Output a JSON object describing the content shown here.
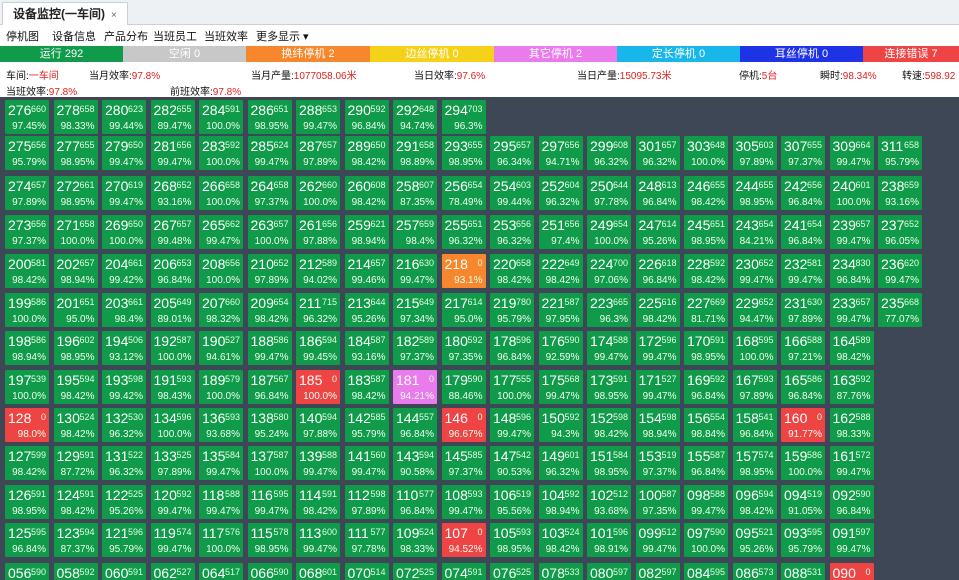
{
  "tab": {
    "title": "设备监控(一车间)",
    "close": "×"
  },
  "menu": [
    "停机图",
    "设备信息",
    "产品分布",
    "当班员工",
    "当班效率",
    "更多显示 ▾"
  ],
  "status": [
    {
      "label": "运行 292",
      "color": "#0f9b49"
    },
    {
      "label": "空闲 0",
      "color": "#c8c8c8"
    },
    {
      "label": "换纬停机 2",
      "color": "#f7872d"
    },
    {
      "label": "边丝停机 0",
      "color": "#f5d21a"
    },
    {
      "label": "其它停机 2",
      "color": "#ea7bec"
    },
    {
      "label": "定长停机 0",
      "color": "#19b7e9"
    },
    {
      "label": "耳丝停机 0",
      "color": "#1e32e6"
    },
    {
      "label": "连接错误 7",
      "color": "#ee4444"
    }
  ],
  "info": {
    "workshop_label": "车间:",
    "workshop": "一车间",
    "month_eff_label": "当月效率:",
    "month_eff": "97.8%",
    "month_out_label": "当月产量:",
    "month_out": "1077058.06米",
    "day_eff_label": "当日效率:",
    "day_eff": "97.6%",
    "day_out_label": "当日产量:",
    "day_out": "15095.73米",
    "stop_label": "停机:",
    "stop": "5台",
    "instant_label": "瞬时:",
    "instant": "98.34%",
    "speed_label": "转速:",
    "speed": "598.92",
    "shift_eff_label": "当班效率:",
    "shift_eff": "97.8%",
    "prev_eff_label": "前班效率:",
    "prev_eff": "97.8%"
  },
  "grid": [
    [
      [
        "276",
        "660",
        "97.45%",
        "g"
      ],
      [
        "278",
        "658",
        "98.33%",
        "g"
      ],
      [
        "280",
        "623",
        "99.44%",
        "g"
      ],
      [
        "282",
        "655",
        "89.47%",
        "g"
      ],
      [
        "284",
        "591",
        "100.0%",
        "g"
      ],
      [
        "286",
        "651",
        "98.95%",
        "g"
      ],
      [
        "288",
        "653",
        "99.47%",
        "g"
      ],
      [
        "290",
        "592",
        "96.84%",
        "g"
      ],
      [
        "292",
        "648",
        "94.74%",
        "g"
      ],
      [
        "294",
        "703",
        "96.3%",
        "g"
      ]
    ],
    [
      [
        "275",
        "656",
        "95.79%",
        "g"
      ],
      [
        "277",
        "655",
        "98.95%",
        "g"
      ],
      [
        "279",
        "650",
        "99.47%",
        "g"
      ],
      [
        "281",
        "656",
        "99.47%",
        "g"
      ],
      [
        "283",
        "592",
        "100.0%",
        "g"
      ],
      [
        "285",
        "624",
        "99.47%",
        "g"
      ],
      [
        "287",
        "657",
        "97.89%",
        "g"
      ],
      [
        "289",
        "650",
        "98.42%",
        "g"
      ],
      [
        "291",
        "658",
        "98.89%",
        "g"
      ],
      [
        "293",
        "655",
        "98.95%",
        "g"
      ],
      [
        "295",
        "657",
        "96.34%",
        "g"
      ],
      [
        "297",
        "656",
        "94.71%",
        "g"
      ],
      [
        "299",
        "608",
        "96.32%",
        "g"
      ],
      [
        "301",
        "657",
        "96.32%",
        "g"
      ],
      [
        "303",
        "648",
        "100.0%",
        "g"
      ],
      [
        "305",
        "603",
        "97.89%",
        "g"
      ],
      [
        "307",
        "655",
        "97.37%",
        "g"
      ],
      [
        "309",
        "664",
        "99.47%",
        "g"
      ],
      [
        "311",
        "658",
        "95.79%",
        "g"
      ]
    ],
    [
      [
        "274",
        "657",
        "97.89%",
        "g"
      ],
      [
        "272",
        "661",
        "98.95%",
        "g"
      ],
      [
        "270",
        "619",
        "99.47%",
        "g"
      ],
      [
        "268",
        "652",
        "93.16%",
        "g"
      ],
      [
        "266",
        "658",
        "100.0%",
        "g"
      ],
      [
        "264",
        "658",
        "97.37%",
        "g"
      ],
      [
        "262",
        "660",
        "100.0%",
        "g"
      ],
      [
        "260",
        "608",
        "98.42%",
        "g"
      ],
      [
        "258",
        "607",
        "87.35%",
        "g"
      ],
      [
        "256",
        "654",
        "78.49%",
        "g"
      ],
      [
        "254",
        "603",
        "99.44%",
        "g"
      ],
      [
        "252",
        "604",
        "96.32%",
        "g"
      ],
      [
        "250",
        "644",
        "97.78%",
        "g"
      ],
      [
        "248",
        "613",
        "96.84%",
        "g"
      ],
      [
        "246",
        "655",
        "98.42%",
        "g"
      ],
      [
        "244",
        "655",
        "98.95%",
        "g"
      ],
      [
        "242",
        "656",
        "96.84%",
        "g"
      ],
      [
        "240",
        "601",
        "100.0%",
        "g"
      ],
      [
        "238",
        "659",
        "93.16%",
        "g"
      ]
    ],
    [
      [
        "273",
        "656",
        "97.37%",
        "g"
      ],
      [
        "271",
        "658",
        "100.0%",
        "g"
      ],
      [
        "269",
        "650",
        "100.0%",
        "g"
      ],
      [
        "267",
        "657",
        "99.48%",
        "g"
      ],
      [
        "265",
        "662",
        "99.47%",
        "g"
      ],
      [
        "263",
        "657",
        "100.0%",
        "g"
      ],
      [
        "261",
        "656",
        "97.88%",
        "g"
      ],
      [
        "259",
        "621",
        "98.94%",
        "g"
      ],
      [
        "257",
        "659",
        "98.4%",
        "g"
      ],
      [
        "255",
        "651",
        "96.32%",
        "g"
      ],
      [
        "253",
        "656",
        "96.32%",
        "g"
      ],
      [
        "251",
        "656",
        "97.4%",
        "g"
      ],
      [
        "249",
        "654",
        "100.0%",
        "g"
      ],
      [
        "247",
        "614",
        "95.26%",
        "g"
      ],
      [
        "245",
        "651",
        "98.95%",
        "g"
      ],
      [
        "243",
        "654",
        "84.21%",
        "g"
      ],
      [
        "241",
        "654",
        "96.84%",
        "g"
      ],
      [
        "239",
        "657",
        "99.47%",
        "g"
      ],
      [
        "237",
        "652",
        "96.05%",
        "g"
      ]
    ],
    [
      [
        "200",
        "581",
        "98.42%",
        "g"
      ],
      [
        "202",
        "657",
        "98.94%",
        "g"
      ],
      [
        "204",
        "661",
        "99.42%",
        "g"
      ],
      [
        "206",
        "653",
        "96.84%",
        "g"
      ],
      [
        "208",
        "656",
        "100.0%",
        "g"
      ],
      [
        "210",
        "652",
        "97.89%",
        "g"
      ],
      [
        "212",
        "589",
        "94.02%",
        "g"
      ],
      [
        "214",
        "657",
        "99.46%",
        "g"
      ],
      [
        "216",
        "630",
        "99.47%",
        "g"
      ],
      [
        "218",
        "0",
        "93.1%",
        "o"
      ],
      [
        "220",
        "658",
        "98.42%",
        "g"
      ],
      [
        "222",
        "649",
        "98.42%",
        "g"
      ],
      [
        "224",
        "700",
        "97.06%",
        "g"
      ],
      [
        "226",
        "618",
        "96.84%",
        "g"
      ],
      [
        "228",
        "592",
        "98.42%",
        "g"
      ],
      [
        "230",
        "652",
        "99.47%",
        "g"
      ],
      [
        "232",
        "581",
        "99.47%",
        "g"
      ],
      [
        "234",
        "830",
        "96.84%",
        "g"
      ],
      [
        "236",
        "620",
        "99.47%",
        "g"
      ]
    ],
    [
      [
        "199",
        "586",
        "100.0%",
        "g"
      ],
      [
        "201",
        "651",
        "95.0%",
        "g"
      ],
      [
        "203",
        "661",
        "98.4%",
        "g"
      ],
      [
        "205",
        "649",
        "89.01%",
        "g"
      ],
      [
        "207",
        "660",
        "98.32%",
        "g"
      ],
      [
        "209",
        "654",
        "98.42%",
        "g"
      ],
      [
        "211",
        "715",
        "96.32%",
        "g"
      ],
      [
        "213",
        "644",
        "95.26%",
        "g"
      ],
      [
        "215",
        "649",
        "97.34%",
        "g"
      ],
      [
        "217",
        "614",
        "95.0%",
        "g"
      ],
      [
        "219",
        "780",
        "95.79%",
        "g"
      ],
      [
        "221",
        "587",
        "97.95%",
        "g"
      ],
      [
        "223",
        "665",
        "96.3%",
        "g"
      ],
      [
        "225",
        "616",
        "98.42%",
        "g"
      ],
      [
        "227",
        "669",
        "81.71%",
        "g"
      ],
      [
        "229",
        "652",
        "94.47%",
        "g"
      ],
      [
        "231",
        "630",
        "97.89%",
        "g"
      ],
      [
        "233",
        "657",
        "99.47%",
        "g"
      ],
      [
        "235",
        "668",
        "77.07%",
        "g"
      ]
    ],
    [
      [
        "198",
        "586",
        "98.94%",
        "g"
      ],
      [
        "196",
        "602",
        "98.95%",
        "g"
      ],
      [
        "194",
        "506",
        "93.12%",
        "g"
      ],
      [
        "192",
        "587",
        "100.0%",
        "g"
      ],
      [
        "190",
        "527",
        "94.61%",
        "g"
      ],
      [
        "188",
        "586",
        "99.47%",
        "g"
      ],
      [
        "186",
        "594",
        "99.45%",
        "g"
      ],
      [
        "184",
        "587",
        "93.16%",
        "g"
      ],
      [
        "182",
        "589",
        "97.37%",
        "g"
      ],
      [
        "180",
        "592",
        "97.35%",
        "g"
      ],
      [
        "178",
        "596",
        "96.84%",
        "g"
      ],
      [
        "176",
        "590",
        "92.59%",
        "g"
      ],
      [
        "174",
        "588",
        "99.47%",
        "g"
      ],
      [
        "172",
        "596",
        "99.47%",
        "g"
      ],
      [
        "170",
        "591",
        "98.95%",
        "g"
      ],
      [
        "168",
        "595",
        "100.0%",
        "g"
      ],
      [
        "166",
        "588",
        "97.21%",
        "g"
      ],
      [
        "164",
        "589",
        "98.42%",
        "g"
      ]
    ],
    [
      [
        "197",
        "539",
        "100.0%",
        "g"
      ],
      [
        "195",
        "594",
        "98.42%",
        "g"
      ],
      [
        "193",
        "598",
        "99.42%",
        "g"
      ],
      [
        "191",
        "593",
        "98.43%",
        "g"
      ],
      [
        "189",
        "579",
        "100.0%",
        "g"
      ],
      [
        "187",
        "567",
        "96.84%",
        "g"
      ],
      [
        "185",
        "0",
        "100.0%",
        "r"
      ],
      [
        "183",
        "587",
        "98.42%",
        "g"
      ],
      [
        "181",
        "0",
        "94.21%",
        "p"
      ],
      [
        "179",
        "590",
        "88.46%",
        "g"
      ],
      [
        "177",
        "555",
        "100.0%",
        "g"
      ],
      [
        "175",
        "568",
        "99.47%",
        "g"
      ],
      [
        "173",
        "591",
        "98.95%",
        "g"
      ],
      [
        "171",
        "527",
        "99.47%",
        "g"
      ],
      [
        "169",
        "592",
        "96.84%",
        "g"
      ],
      [
        "167",
        "593",
        "97.89%",
        "g"
      ],
      [
        "165",
        "586",
        "96.84%",
        "g"
      ],
      [
        "163",
        "592",
        "87.76%",
        "g"
      ]
    ],
    [
      [
        "128",
        "0",
        "98.0%",
        "r"
      ],
      [
        "130",
        "524",
        "98.42%",
        "g"
      ],
      [
        "132",
        "530",
        "96.32%",
        "g"
      ],
      [
        "134",
        "596",
        "100.0%",
        "g"
      ],
      [
        "136",
        "593",
        "93.68%",
        "g"
      ],
      [
        "138",
        "580",
        "95.24%",
        "g"
      ],
      [
        "140",
        "594",
        "97.88%",
        "g"
      ],
      [
        "142",
        "585",
        "95.79%",
        "g"
      ],
      [
        "144",
        "557",
        "96.84%",
        "g"
      ],
      [
        "146",
        "0",
        "96.67%",
        "r"
      ],
      [
        "148",
        "596",
        "99.47%",
        "g"
      ],
      [
        "150",
        "592",
        "94.3%",
        "g"
      ],
      [
        "152",
        "598",
        "98.42%",
        "g"
      ],
      [
        "154",
        "598",
        "98.94%",
        "g"
      ],
      [
        "156",
        "554",
        "98.84%",
        "g"
      ],
      [
        "158",
        "541",
        "96.84%",
        "g"
      ],
      [
        "160",
        "0",
        "91.77%",
        "r"
      ],
      [
        "162",
        "588",
        "98.33%",
        "g"
      ]
    ],
    [
      [
        "127",
        "599",
        "98.42%",
        "g"
      ],
      [
        "129",
        "591",
        "87.72%",
        "g"
      ],
      [
        "131",
        "522",
        "96.32%",
        "g"
      ],
      [
        "133",
        "525",
        "97.89%",
        "g"
      ],
      [
        "135",
        "584",
        "99.47%",
        "g"
      ],
      [
        "137",
        "587",
        "100.0%",
        "g"
      ],
      [
        "139",
        "588",
        "99.47%",
        "g"
      ],
      [
        "141",
        "560",
        "99.47%",
        "g"
      ],
      [
        "143",
        "594",
        "90.58%",
        "g"
      ],
      [
        "145",
        "585",
        "97.37%",
        "g"
      ],
      [
        "147",
        "542",
        "90.53%",
        "g"
      ],
      [
        "149",
        "601",
        "96.32%",
        "g"
      ],
      [
        "151",
        "584",
        "98.95%",
        "g"
      ],
      [
        "153",
        "519",
        "97.37%",
        "g"
      ],
      [
        "155",
        "587",
        "96.84%",
        "g"
      ],
      [
        "157",
        "574",
        "98.95%",
        "g"
      ],
      [
        "159",
        "586",
        "100.0%",
        "g"
      ],
      [
        "161",
        "572",
        "99.47%",
        "g"
      ]
    ],
    [
      [
        "126",
        "591",
        "98.95%",
        "g"
      ],
      [
        "124",
        "591",
        "98.42%",
        "g"
      ],
      [
        "122",
        "525",
        "95.26%",
        "g"
      ],
      [
        "120",
        "592",
        "99.47%",
        "g"
      ],
      [
        "118",
        "588",
        "99.47%",
        "g"
      ],
      [
        "116",
        "595",
        "99.47%",
        "g"
      ],
      [
        "114",
        "591",
        "98.42%",
        "g"
      ],
      [
        "112",
        "598",
        "97.89%",
        "g"
      ],
      [
        "110",
        "577",
        "96.84%",
        "g"
      ],
      [
        "108",
        "593",
        "99.47%",
        "g"
      ],
      [
        "106",
        "519",
        "95.56%",
        "g"
      ],
      [
        "104",
        "592",
        "98.94%",
        "g"
      ],
      [
        "102",
        "512",
        "93.68%",
        "g"
      ],
      [
        "100",
        "587",
        "97.35%",
        "g"
      ],
      [
        "098",
        "588",
        "99.47%",
        "g"
      ],
      [
        "096",
        "594",
        "98.42%",
        "g"
      ],
      [
        "094",
        "519",
        "91.05%",
        "g"
      ],
      [
        "092",
        "590",
        "96.84%",
        "g"
      ]
    ],
    [
      [
        "125",
        "595",
        "96.84%",
        "g"
      ],
      [
        "123",
        "594",
        "87.37%",
        "g"
      ],
      [
        "121",
        "596",
        "95.79%",
        "g"
      ],
      [
        "119",
        "574",
        "99.47%",
        "g"
      ],
      [
        "117",
        "576",
        "100.0%",
        "g"
      ],
      [
        "115",
        "578",
        "98.95%",
        "g"
      ],
      [
        "113",
        "600",
        "99.47%",
        "g"
      ],
      [
        "111",
        "577",
        "97.78%",
        "g"
      ],
      [
        "109",
        "524",
        "98.33%",
        "g"
      ],
      [
        "107",
        "0",
        "94.52%",
        "r"
      ],
      [
        "105",
        "593",
        "98.95%",
        "g"
      ],
      [
        "103",
        "524",
        "98.42%",
        "g"
      ],
      [
        "101",
        "596",
        "98.91%",
        "g"
      ],
      [
        "099",
        "512",
        "99.47%",
        "g"
      ],
      [
        "097",
        "590",
        "100.0%",
        "g"
      ],
      [
        "095",
        "521",
        "95.26%",
        "g"
      ],
      [
        "093",
        "595",
        "95.79%",
        "g"
      ],
      [
        "091",
        "597",
        "99.47%",
        "g"
      ]
    ],
    [
      [
        "056",
        "590",
        "",
        "g"
      ],
      [
        "058",
        "592",
        "",
        "g"
      ],
      [
        "060",
        "591",
        "",
        "g"
      ],
      [
        "062",
        "527",
        "",
        "g"
      ],
      [
        "064",
        "517",
        "",
        "g"
      ],
      [
        "066",
        "590",
        "",
        "g"
      ],
      [
        "068",
        "601",
        "",
        "g"
      ],
      [
        "070",
        "514",
        "",
        "g"
      ],
      [
        "072",
        "525",
        "",
        "g"
      ],
      [
        "074",
        "591",
        "",
        "g"
      ],
      [
        "076",
        "525",
        "",
        "g"
      ],
      [
        "078",
        "533",
        "",
        "g"
      ],
      [
        "080",
        "597",
        "",
        "g"
      ],
      [
        "082",
        "597",
        "",
        "g"
      ],
      [
        "084",
        "595",
        "",
        "g"
      ],
      [
        "086",
        "573",
        "",
        "g"
      ],
      [
        "088",
        "531",
        "",
        "g"
      ],
      [
        "090",
        "0",
        "",
        "r"
      ]
    ]
  ]
}
